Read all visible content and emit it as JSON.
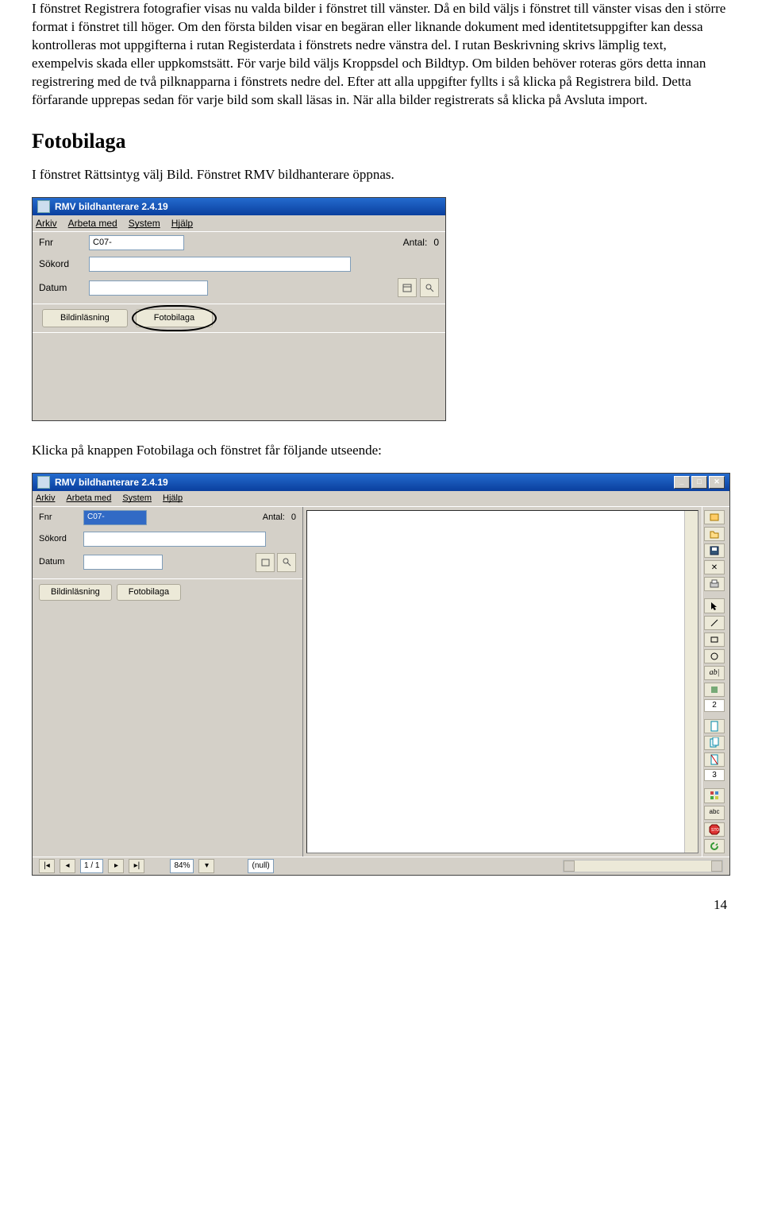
{
  "para1": "I fönstret Registrera fotografier visas nu valda bilder i fönstret till vänster. Då en bild väljs i fönstret till vänster visas den i större format i fönstret till höger. Om den första bilden visar en begäran eller liknande dokument med identitetsuppgifter kan dessa kontrolleras mot uppgifterna i rutan Registerdata i fönstrets nedre vänstra del. I rutan Beskrivning skrivs lämplig text, exempelvis skada eller uppkomstsätt. För varje bild väljs Kroppsdel och Bildtyp. Om bilden behöver roteras görs detta innan registrering med de två pilknapparna i fönstrets nedre del. Efter att alla uppgifter fyllts i så klicka på Registrera bild. Detta förfarande upprepas sedan för varje bild som skall läsas in. När alla bilder registrerats så klicka på Avsluta import.",
  "heading": "Fotobilaga",
  "para2": "I fönstret Rättsintyg välj Bild. Fönstret RMV bildhanterare öppnas.",
  "para3": "Klicka på knappen Fotobilaga och fönstret får följande utseende:",
  "screens": {
    "app_title": "RMV bildhanterare 2.4.19",
    "menu": {
      "file": "Arkiv",
      "work": "Arbeta med",
      "system": "System",
      "help": "Hjälp"
    },
    "form": {
      "fnr_label": "Fnr",
      "fnr_value": "C07-",
      "antal_label": "Antal:",
      "antal_value": "0",
      "sokord_label": "Sökord",
      "datum_label": "Datum"
    },
    "tabs": {
      "inlas": "Bildinläsning",
      "foto": "Fotobilaga"
    }
  },
  "status": {
    "page": "1 / 1",
    "zoom": "84%",
    "null": "(null)"
  },
  "right": {
    "group_a": "2",
    "group_b": "3"
  },
  "pagenum": "14"
}
